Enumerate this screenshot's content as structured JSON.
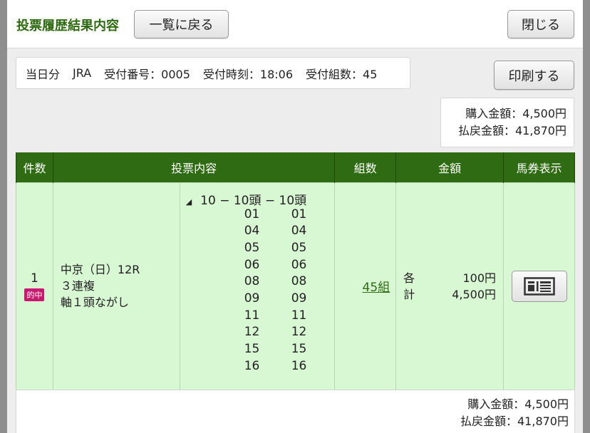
{
  "header": {
    "title": "投票履歴結果内容",
    "back_label": "一覧に戻る",
    "close_label": "閉じる"
  },
  "info": {
    "day": "当日分",
    "org": "JRA",
    "receipt_no": "受付番号：0005",
    "receipt_time": "受付時刻：18:06",
    "receipt_sets": "受付組数：45"
  },
  "print_label": "印刷する",
  "summary": {
    "purchase": "購入金額：4,500円",
    "payout": "払戻金額：41,870円"
  },
  "table": {
    "headers": [
      "件数",
      "投票内容",
      "組数",
      "金額",
      "馬券表示"
    ],
    "rows": [
      {
        "count": "1",
        "hit": "的中",
        "race": "中京（日）12R",
        "bet_type": "３連複",
        "method": "軸１頭ながし",
        "combo_head": "10 − 10頭 − 10頭",
        "col1": [
          "01",
          "04",
          "05",
          "06",
          "08",
          "09",
          "11",
          "12",
          "15",
          "16"
        ],
        "col2": [
          "01",
          "04",
          "05",
          "06",
          "08",
          "09",
          "11",
          "12",
          "15",
          "16"
        ],
        "sets": "45組",
        "each_label": "各",
        "each_amount": "100円",
        "total_label": "計",
        "total_amount": "4,500円",
        "ticket_icon": "ticket-icon"
      }
    ]
  },
  "footer": {
    "purchase": "購入金額：4,500円",
    "payout": "払戻金額：41,870円"
  },
  "colors": {
    "green": "#2f6b12",
    "row_bg": "#d8f7d3",
    "hit_badge": "#c9196f"
  }
}
